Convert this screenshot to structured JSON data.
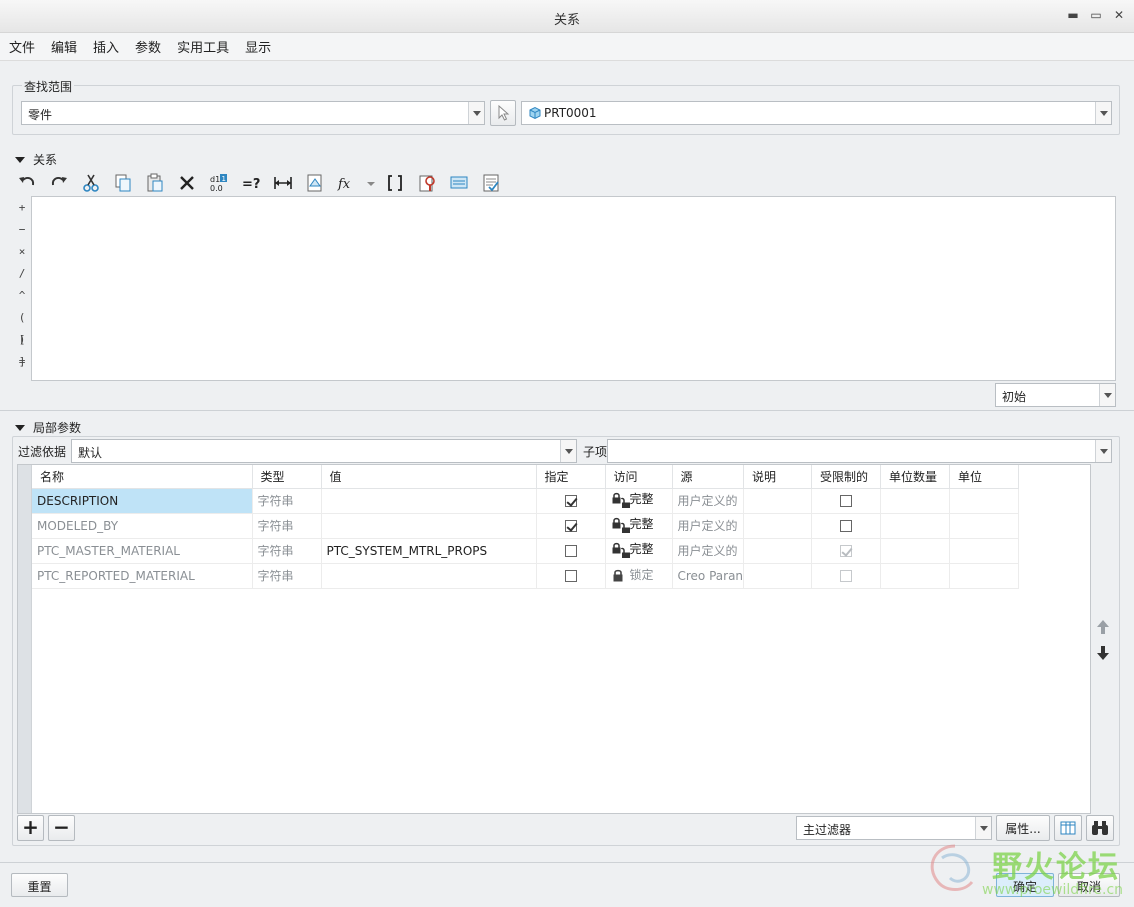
{
  "window": {
    "title": "关系"
  },
  "menu": [
    "文件",
    "编辑",
    "插入",
    "参数",
    "实用工具",
    "显示"
  ],
  "scope": {
    "group_label": "查找范围",
    "type_value": "零件",
    "model_value": "PRT0001"
  },
  "relations": {
    "section_label": "关系",
    "toolbar_icons": [
      "undo-icon",
      "redo-icon",
      "cut-icon",
      "copy-icon",
      "paste-icon",
      "delete-icon",
      "sort-icon",
      "evaluate-icon",
      "units-icon",
      "insert-param-icon",
      "function-icon",
      "function-dropdown-icon",
      "brackets-icon",
      "verify-icon",
      "display-icon",
      "notes-icon"
    ],
    "operators": [
      "+",
      "−",
      "×",
      "/",
      "^",
      "( )",
      "[ ]",
      "="
    ],
    "editor_text": "",
    "state_value": "初始"
  },
  "params": {
    "section_label": "局部参数",
    "filter_label": "过滤依据",
    "filter_value": "默认",
    "child_label": "子项",
    "child_value": "",
    "columns": [
      "名称",
      "类型",
      "值",
      "指定",
      "访问",
      "源",
      "说明",
      "受限制的",
      "单位数量",
      "单位"
    ],
    "rows": [
      {
        "name": "DESCRIPTION",
        "type": "字符串",
        "value": "",
        "designate": true,
        "access": "完整",
        "access_kind": "full",
        "source": "用户定义的",
        "desc": "",
        "restricted": false,
        "restricted_disabled": false
      },
      {
        "name": "MODELED_BY",
        "type": "字符串",
        "value": "",
        "designate": true,
        "access": "完整",
        "access_kind": "full",
        "source": "用户定义的",
        "desc": "",
        "restricted": false,
        "restricted_disabled": false
      },
      {
        "name": "PTC_MASTER_MATERIAL",
        "type": "字符串",
        "value": "PTC_SYSTEM_MTRL_PROPS",
        "designate": false,
        "access": "完整",
        "access_kind": "full",
        "source": "用户定义的",
        "desc": "",
        "restricted": true,
        "restricted_disabled": true
      },
      {
        "name": "PTC_REPORTED_MATERIAL",
        "type": "字符串",
        "value": "",
        "designate": false,
        "access": "锁定",
        "access_kind": "locked",
        "source": "Creo Paran",
        "desc": "",
        "restricted": false,
        "restricted_disabled": true
      }
    ],
    "main_filter_value": "主过滤器",
    "properties_label": "属性...",
    "add_label": "+",
    "remove_label": "−"
  },
  "footer": {
    "reset_label": "重置",
    "ok_label": "确定",
    "cancel_label": "取消"
  },
  "watermark": {
    "text": "野火论坛",
    "url": "www.proewildfire.cn"
  },
  "colors": {
    "selection": "#bfe3f7",
    "watermark_green": "#7dd34a"
  }
}
